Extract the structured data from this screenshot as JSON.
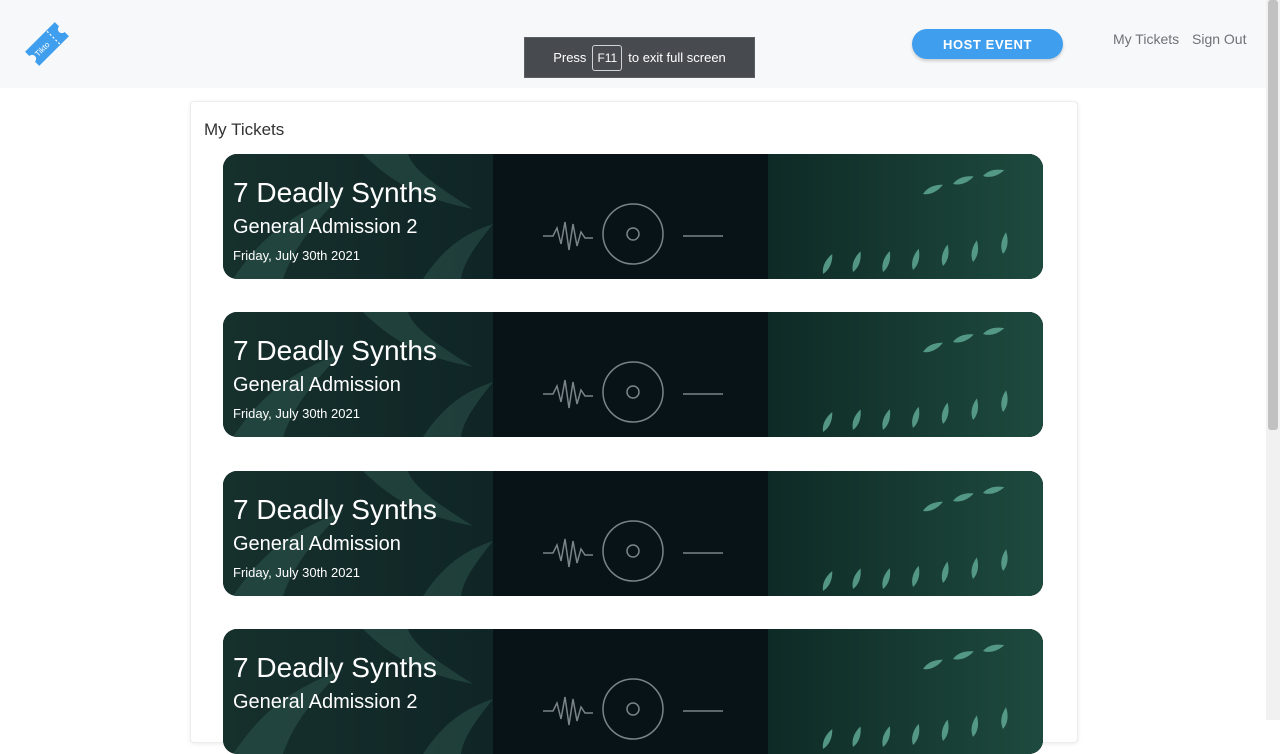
{
  "header": {
    "logo_text": "Tikto",
    "fullscreen_hint": {
      "before": "Press",
      "key": "F11",
      "after": "to exit full screen"
    },
    "host_button_label": "HOST EVENT",
    "nav": {
      "my_tickets": "My Tickets",
      "sign_out": "Sign Out"
    }
  },
  "main": {
    "title": "My Tickets",
    "tickets": [
      {
        "event": "7 Deadly Synths",
        "admission": "General Admission 2",
        "date": "Friday, July 30th 2021"
      },
      {
        "event": "7 Deadly Synths",
        "admission": "General Admission",
        "date": "Friday, July 30th 2021"
      },
      {
        "event": "7 Deadly Synths",
        "admission": "General Admission",
        "date": "Friday, July 30th 2021"
      },
      {
        "event": "7 Deadly Synths",
        "admission": "General Admission 2",
        "date": ""
      }
    ]
  },
  "colors": {
    "accent": "#3f9fee",
    "topbar": "#f7f8fa",
    "ticket_bg": "#0a1a1d",
    "leaf": "#5fa894"
  }
}
